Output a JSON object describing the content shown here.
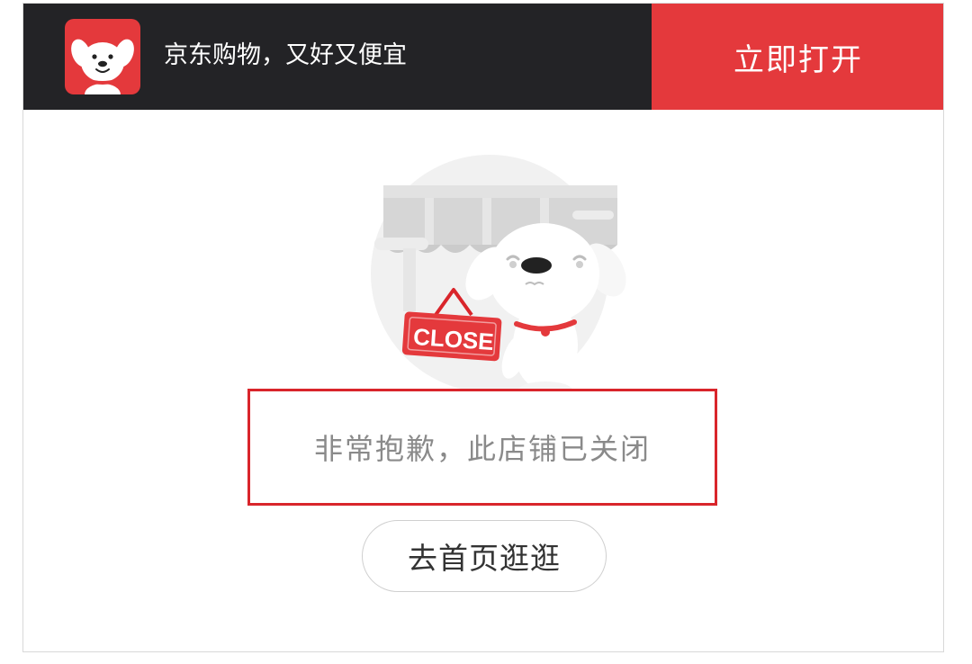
{
  "banner": {
    "app_name": "京东购物，又好又便宜",
    "open_label": "立即打开",
    "icon": "jd-dog-logo-icon"
  },
  "illustration": {
    "sign_text": "CLOSE",
    "icon": "closed-store-dog-illustration"
  },
  "message": {
    "text": "非常抱歉，此店铺已关闭"
  },
  "actions": {
    "home_label": "去首页逛逛"
  },
  "colors": {
    "accent": "#e4393c",
    "banner_bg": "#232326",
    "highlight_border": "#d9252b",
    "message_text": "#8a8a8a"
  }
}
